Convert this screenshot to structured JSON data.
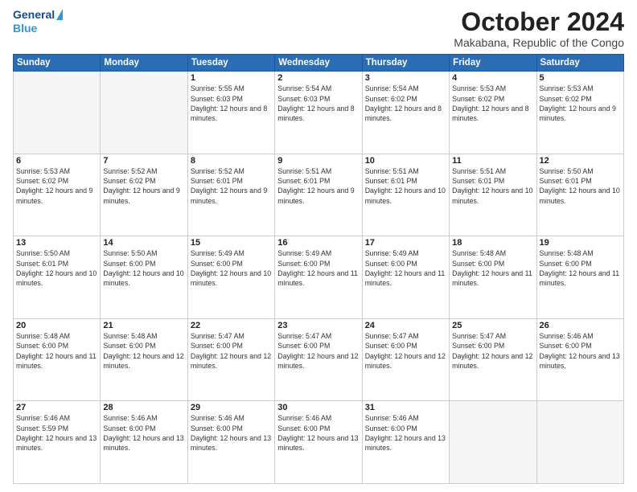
{
  "logo": {
    "general": "General",
    "blue": "Blue"
  },
  "title": "October 2024",
  "location": "Makabana, Republic of the Congo",
  "days_of_week": [
    "Sunday",
    "Monday",
    "Tuesday",
    "Wednesday",
    "Thursday",
    "Friday",
    "Saturday"
  ],
  "weeks": [
    [
      {
        "day": "",
        "sunrise": "",
        "sunset": "",
        "daylight": "",
        "empty": true
      },
      {
        "day": "",
        "sunrise": "",
        "sunset": "",
        "daylight": "",
        "empty": true
      },
      {
        "day": "1",
        "sunrise": "Sunrise: 5:55 AM",
        "sunset": "Sunset: 6:03 PM",
        "daylight": "Daylight: 12 hours and 8 minutes.",
        "empty": false
      },
      {
        "day": "2",
        "sunrise": "Sunrise: 5:54 AM",
        "sunset": "Sunset: 6:03 PM",
        "daylight": "Daylight: 12 hours and 8 minutes.",
        "empty": false
      },
      {
        "day": "3",
        "sunrise": "Sunrise: 5:54 AM",
        "sunset": "Sunset: 6:02 PM",
        "daylight": "Daylight: 12 hours and 8 minutes.",
        "empty": false
      },
      {
        "day": "4",
        "sunrise": "Sunrise: 5:53 AM",
        "sunset": "Sunset: 6:02 PM",
        "daylight": "Daylight: 12 hours and 8 minutes.",
        "empty": false
      },
      {
        "day": "5",
        "sunrise": "Sunrise: 5:53 AM",
        "sunset": "Sunset: 6:02 PM",
        "daylight": "Daylight: 12 hours and 9 minutes.",
        "empty": false
      }
    ],
    [
      {
        "day": "6",
        "sunrise": "Sunrise: 5:53 AM",
        "sunset": "Sunset: 6:02 PM",
        "daylight": "Daylight: 12 hours and 9 minutes.",
        "empty": false
      },
      {
        "day": "7",
        "sunrise": "Sunrise: 5:52 AM",
        "sunset": "Sunset: 6:02 PM",
        "daylight": "Daylight: 12 hours and 9 minutes.",
        "empty": false
      },
      {
        "day": "8",
        "sunrise": "Sunrise: 5:52 AM",
        "sunset": "Sunset: 6:01 PM",
        "daylight": "Daylight: 12 hours and 9 minutes.",
        "empty": false
      },
      {
        "day": "9",
        "sunrise": "Sunrise: 5:51 AM",
        "sunset": "Sunset: 6:01 PM",
        "daylight": "Daylight: 12 hours and 9 minutes.",
        "empty": false
      },
      {
        "day": "10",
        "sunrise": "Sunrise: 5:51 AM",
        "sunset": "Sunset: 6:01 PM",
        "daylight": "Daylight: 12 hours and 10 minutes.",
        "empty": false
      },
      {
        "day": "11",
        "sunrise": "Sunrise: 5:51 AM",
        "sunset": "Sunset: 6:01 PM",
        "daylight": "Daylight: 12 hours and 10 minutes.",
        "empty": false
      },
      {
        "day": "12",
        "sunrise": "Sunrise: 5:50 AM",
        "sunset": "Sunset: 6:01 PM",
        "daylight": "Daylight: 12 hours and 10 minutes.",
        "empty": false
      }
    ],
    [
      {
        "day": "13",
        "sunrise": "Sunrise: 5:50 AM",
        "sunset": "Sunset: 6:01 PM",
        "daylight": "Daylight: 12 hours and 10 minutes.",
        "empty": false
      },
      {
        "day": "14",
        "sunrise": "Sunrise: 5:50 AM",
        "sunset": "Sunset: 6:00 PM",
        "daylight": "Daylight: 12 hours and 10 minutes.",
        "empty": false
      },
      {
        "day": "15",
        "sunrise": "Sunrise: 5:49 AM",
        "sunset": "Sunset: 6:00 PM",
        "daylight": "Daylight: 12 hours and 10 minutes.",
        "empty": false
      },
      {
        "day": "16",
        "sunrise": "Sunrise: 5:49 AM",
        "sunset": "Sunset: 6:00 PM",
        "daylight": "Daylight: 12 hours and 11 minutes.",
        "empty": false
      },
      {
        "day": "17",
        "sunrise": "Sunrise: 5:49 AM",
        "sunset": "Sunset: 6:00 PM",
        "daylight": "Daylight: 12 hours and 11 minutes.",
        "empty": false
      },
      {
        "day": "18",
        "sunrise": "Sunrise: 5:48 AM",
        "sunset": "Sunset: 6:00 PM",
        "daylight": "Daylight: 12 hours and 11 minutes.",
        "empty": false
      },
      {
        "day": "19",
        "sunrise": "Sunrise: 5:48 AM",
        "sunset": "Sunset: 6:00 PM",
        "daylight": "Daylight: 12 hours and 11 minutes.",
        "empty": false
      }
    ],
    [
      {
        "day": "20",
        "sunrise": "Sunrise: 5:48 AM",
        "sunset": "Sunset: 6:00 PM",
        "daylight": "Daylight: 12 hours and 11 minutes.",
        "empty": false
      },
      {
        "day": "21",
        "sunrise": "Sunrise: 5:48 AM",
        "sunset": "Sunset: 6:00 PM",
        "daylight": "Daylight: 12 hours and 12 minutes.",
        "empty": false
      },
      {
        "day": "22",
        "sunrise": "Sunrise: 5:47 AM",
        "sunset": "Sunset: 6:00 PM",
        "daylight": "Daylight: 12 hours and 12 minutes.",
        "empty": false
      },
      {
        "day": "23",
        "sunrise": "Sunrise: 5:47 AM",
        "sunset": "Sunset: 6:00 PM",
        "daylight": "Daylight: 12 hours and 12 minutes.",
        "empty": false
      },
      {
        "day": "24",
        "sunrise": "Sunrise: 5:47 AM",
        "sunset": "Sunset: 6:00 PM",
        "daylight": "Daylight: 12 hours and 12 minutes.",
        "empty": false
      },
      {
        "day": "25",
        "sunrise": "Sunrise: 5:47 AM",
        "sunset": "Sunset: 6:00 PM",
        "daylight": "Daylight: 12 hours and 12 minutes.",
        "empty": false
      },
      {
        "day": "26",
        "sunrise": "Sunrise: 5:46 AM",
        "sunset": "Sunset: 6:00 PM",
        "daylight": "Daylight: 12 hours and 13 minutes.",
        "empty": false
      }
    ],
    [
      {
        "day": "27",
        "sunrise": "Sunrise: 5:46 AM",
        "sunset": "Sunset: 5:59 PM",
        "daylight": "Daylight: 12 hours and 13 minutes.",
        "empty": false
      },
      {
        "day": "28",
        "sunrise": "Sunrise: 5:46 AM",
        "sunset": "Sunset: 6:00 PM",
        "daylight": "Daylight: 12 hours and 13 minutes.",
        "empty": false
      },
      {
        "day": "29",
        "sunrise": "Sunrise: 5:46 AM",
        "sunset": "Sunset: 6:00 PM",
        "daylight": "Daylight: 12 hours and 13 minutes.",
        "empty": false
      },
      {
        "day": "30",
        "sunrise": "Sunrise: 5:46 AM",
        "sunset": "Sunset: 6:00 PM",
        "daylight": "Daylight: 12 hours and 13 minutes.",
        "empty": false
      },
      {
        "day": "31",
        "sunrise": "Sunrise: 5:46 AM",
        "sunset": "Sunset: 6:00 PM",
        "daylight": "Daylight: 12 hours and 13 minutes.",
        "empty": false
      },
      {
        "day": "",
        "sunrise": "",
        "sunset": "",
        "daylight": "",
        "empty": true
      },
      {
        "day": "",
        "sunrise": "",
        "sunset": "",
        "daylight": "",
        "empty": true
      }
    ]
  ]
}
